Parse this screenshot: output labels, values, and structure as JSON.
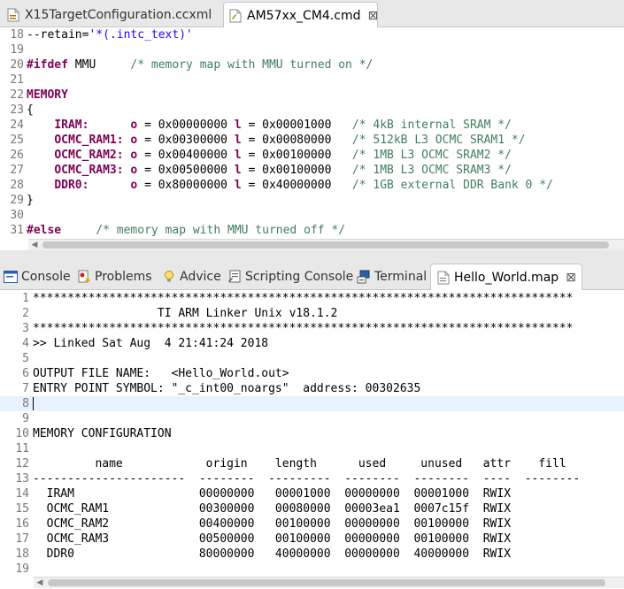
{
  "editor_tabs": [
    {
      "label": "X15TargetConfiguration.ccxml",
      "icon": "xml-file-icon"
    },
    {
      "label": "AM57xx_CM4.cmd",
      "icon": "cmd-file-icon"
    }
  ],
  "cmd_lines": [
    {
      "n": "18",
      "text": "--retain='*(.intc_text)'"
    },
    {
      "n": "19",
      "text": ""
    },
    {
      "n": "20",
      "text": "#ifdef MMU     /* memory map with MMU turned on */"
    },
    {
      "n": "21",
      "text": ""
    },
    {
      "n": "22",
      "text": "MEMORY"
    },
    {
      "n": "23",
      "text": "{"
    },
    {
      "n": "24",
      "text": "    IRAM:      o = 0x00000000 l = 0x00001000   /* 4kB internal SRAM */"
    },
    {
      "n": "25",
      "text": "    OCMC_RAM1: o = 0x00300000 l = 0x00080000   /* 512kB L3 OCMC SRAM1 */"
    },
    {
      "n": "26",
      "text": "    OCMC_RAM2: o = 0x00400000 l = 0x00100000   /* 1MB L3 OCMC SRAM2 */"
    },
    {
      "n": "27",
      "text": "    OCMC_RAM3: o = 0x00500000 l = 0x00100000   /* 1MB L3 OCMC SRAM3 */"
    },
    {
      "n": "28",
      "text": "    DDR0:      o = 0x80000000 l = 0x40000000   /* 1GB external DDR Bank 0 */"
    },
    {
      "n": "29",
      "text": "}"
    },
    {
      "n": "30",
      "text": ""
    },
    {
      "n": "31",
      "text": "#else     /* memory map with MMU turned off */"
    }
  ],
  "view_tabs": [
    {
      "label": "Console",
      "icon": "console-icon"
    },
    {
      "label": "Problems",
      "icon": "problems-icon"
    },
    {
      "label": "Advice",
      "icon": "lightbulb-icon"
    },
    {
      "label": "Scripting Console",
      "icon": "scripting-console-icon"
    },
    {
      "label": "Terminal",
      "icon": "terminal-icon"
    },
    {
      "label": "Hello_World.map",
      "icon": "map-file-icon"
    }
  ],
  "map_lines": [
    {
      "n": "1",
      "text": "******************************************************************************"
    },
    {
      "n": "2",
      "text": "                  TI ARM Linker Unix v18.1.2"
    },
    {
      "n": "3",
      "text": "******************************************************************************"
    },
    {
      "n": "4",
      "text": ">> Linked Sat Aug  4 21:41:24 2018"
    },
    {
      "n": "5",
      "text": ""
    },
    {
      "n": "6",
      "text": "OUTPUT FILE NAME:   <Hello_World.out>"
    },
    {
      "n": "7",
      "text": "ENTRY POINT SYMBOL: \"_c_int00_noargs\"  address: 00302635"
    },
    {
      "n": "8",
      "text": ""
    },
    {
      "n": "9",
      "text": ""
    },
    {
      "n": "10",
      "text": "MEMORY CONFIGURATION"
    },
    {
      "n": "11",
      "text": ""
    },
    {
      "n": "12",
      "text": "         name            origin    length      used     unused   attr    fill"
    },
    {
      "n": "13",
      "text": "----------------------  --------  ---------  --------  --------  ----  --------"
    },
    {
      "n": "14",
      "text": "  IRAM                  00000000   00001000  00000000  00001000  RWIX"
    },
    {
      "n": "15",
      "text": "  OCMC_RAM1             00300000   00080000  00003ea1  0007c15f  RWIX"
    },
    {
      "n": "16",
      "text": "  OCMC_RAM2             00400000   00100000  00000000  00100000  RWIX"
    },
    {
      "n": "17",
      "text": "  OCMC_RAM3             00500000   00100000  00000000  00100000  RWIX"
    },
    {
      "n": "18",
      "text": "  DDR0                  80000000   40000000  00000000  40000000  RWIX"
    },
    {
      "n": "19",
      "text": ""
    }
  ],
  "colors": {
    "keyword": "#7f0055",
    "comment": "#3f7f5f",
    "string": "#2a00ff",
    "line_number": "#787878",
    "current_line": "#e8f2fe"
  }
}
